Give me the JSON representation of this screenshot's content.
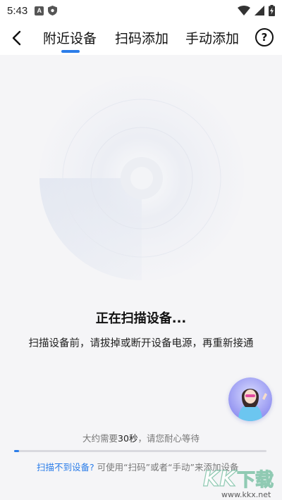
{
  "status_bar": {
    "time": "5:43",
    "app_icon_letter": "A",
    "icons": [
      "a-app-icon",
      "shield-icon",
      "wifi-icon",
      "signal-icon",
      "battery-charging-icon"
    ]
  },
  "nav": {
    "back_icon": "chevron-left-icon",
    "tabs": [
      {
        "label": "附近设备",
        "active": true
      },
      {
        "label": "扫码添加",
        "active": false
      },
      {
        "label": "手动添加",
        "active": false
      }
    ],
    "help_label": "?",
    "accent_color": "#2b7de9"
  },
  "scan": {
    "title": "正在扫描设备...",
    "hint": "扫描设备前，请拔掉或断开设备电源，再重新接通"
  },
  "assistant": {
    "icon": "assistant-avatar"
  },
  "wait": {
    "prefix": "大约需要",
    "duration": "30秒",
    "suffix": "，请您耐心等待",
    "progress": 0.02
  },
  "help_line": {
    "link": "扫描不到设备?",
    "text": " 可使用“扫码”或者“手动”来添加设备"
  },
  "watermark": {
    "text": "KK下载",
    "url": "www.kkx.net"
  }
}
